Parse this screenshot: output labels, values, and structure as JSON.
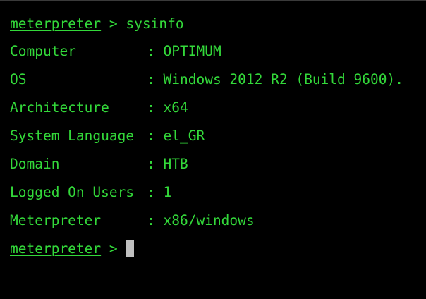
{
  "prompt": {
    "name": "meterpreter",
    "symbol": ">"
  },
  "command": "sysinfo",
  "separator": ":",
  "sysinfo": [
    {
      "key": "Computer",
      "value": "OPTIMUM"
    },
    {
      "key": "OS",
      "value": "Windows 2012 R2 (Build 9600)."
    },
    {
      "key": "Architecture",
      "value": "x64"
    },
    {
      "key": "System Language",
      "value": "el_GR"
    },
    {
      "key": "Domain",
      "value": "HTB"
    },
    {
      "key": "Logged On Users",
      "value": "1"
    },
    {
      "key": "Meterpreter",
      "value": "x86/windows"
    }
  ],
  "colors": {
    "background": "#000000",
    "text": "#33d93a",
    "cursor": "#bfbfbf"
  }
}
